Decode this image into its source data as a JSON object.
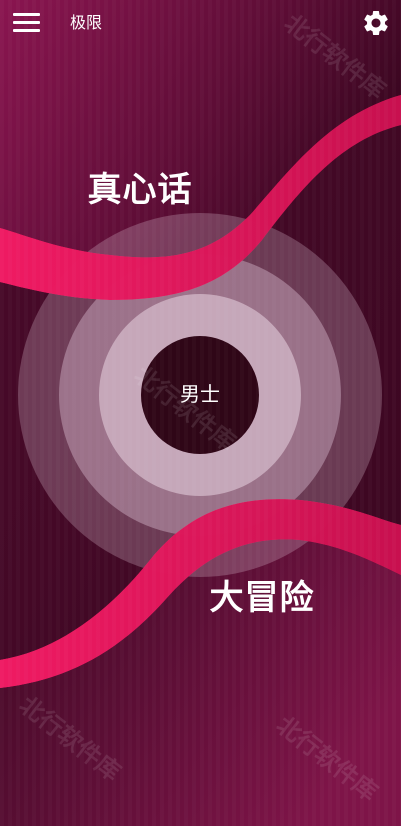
{
  "header": {
    "menu_icon": "hamburger-menu-icon",
    "title": "极限",
    "settings_icon": "gear-icon"
  },
  "main": {
    "truth_label": "真心话",
    "dare_label": "大冒险",
    "center_label": "男士"
  },
  "watermark": {
    "text": "北行软件库"
  },
  "colors": {
    "background_dark": "#3a0a22",
    "background_mid": "#6b1440",
    "wave_accent": "#e0135a",
    "ring_outer": "#7a4a63",
    "ring_mid": "#9a7088",
    "ring_inner": "#bfa0b2",
    "center_circle": "#2f0617"
  }
}
